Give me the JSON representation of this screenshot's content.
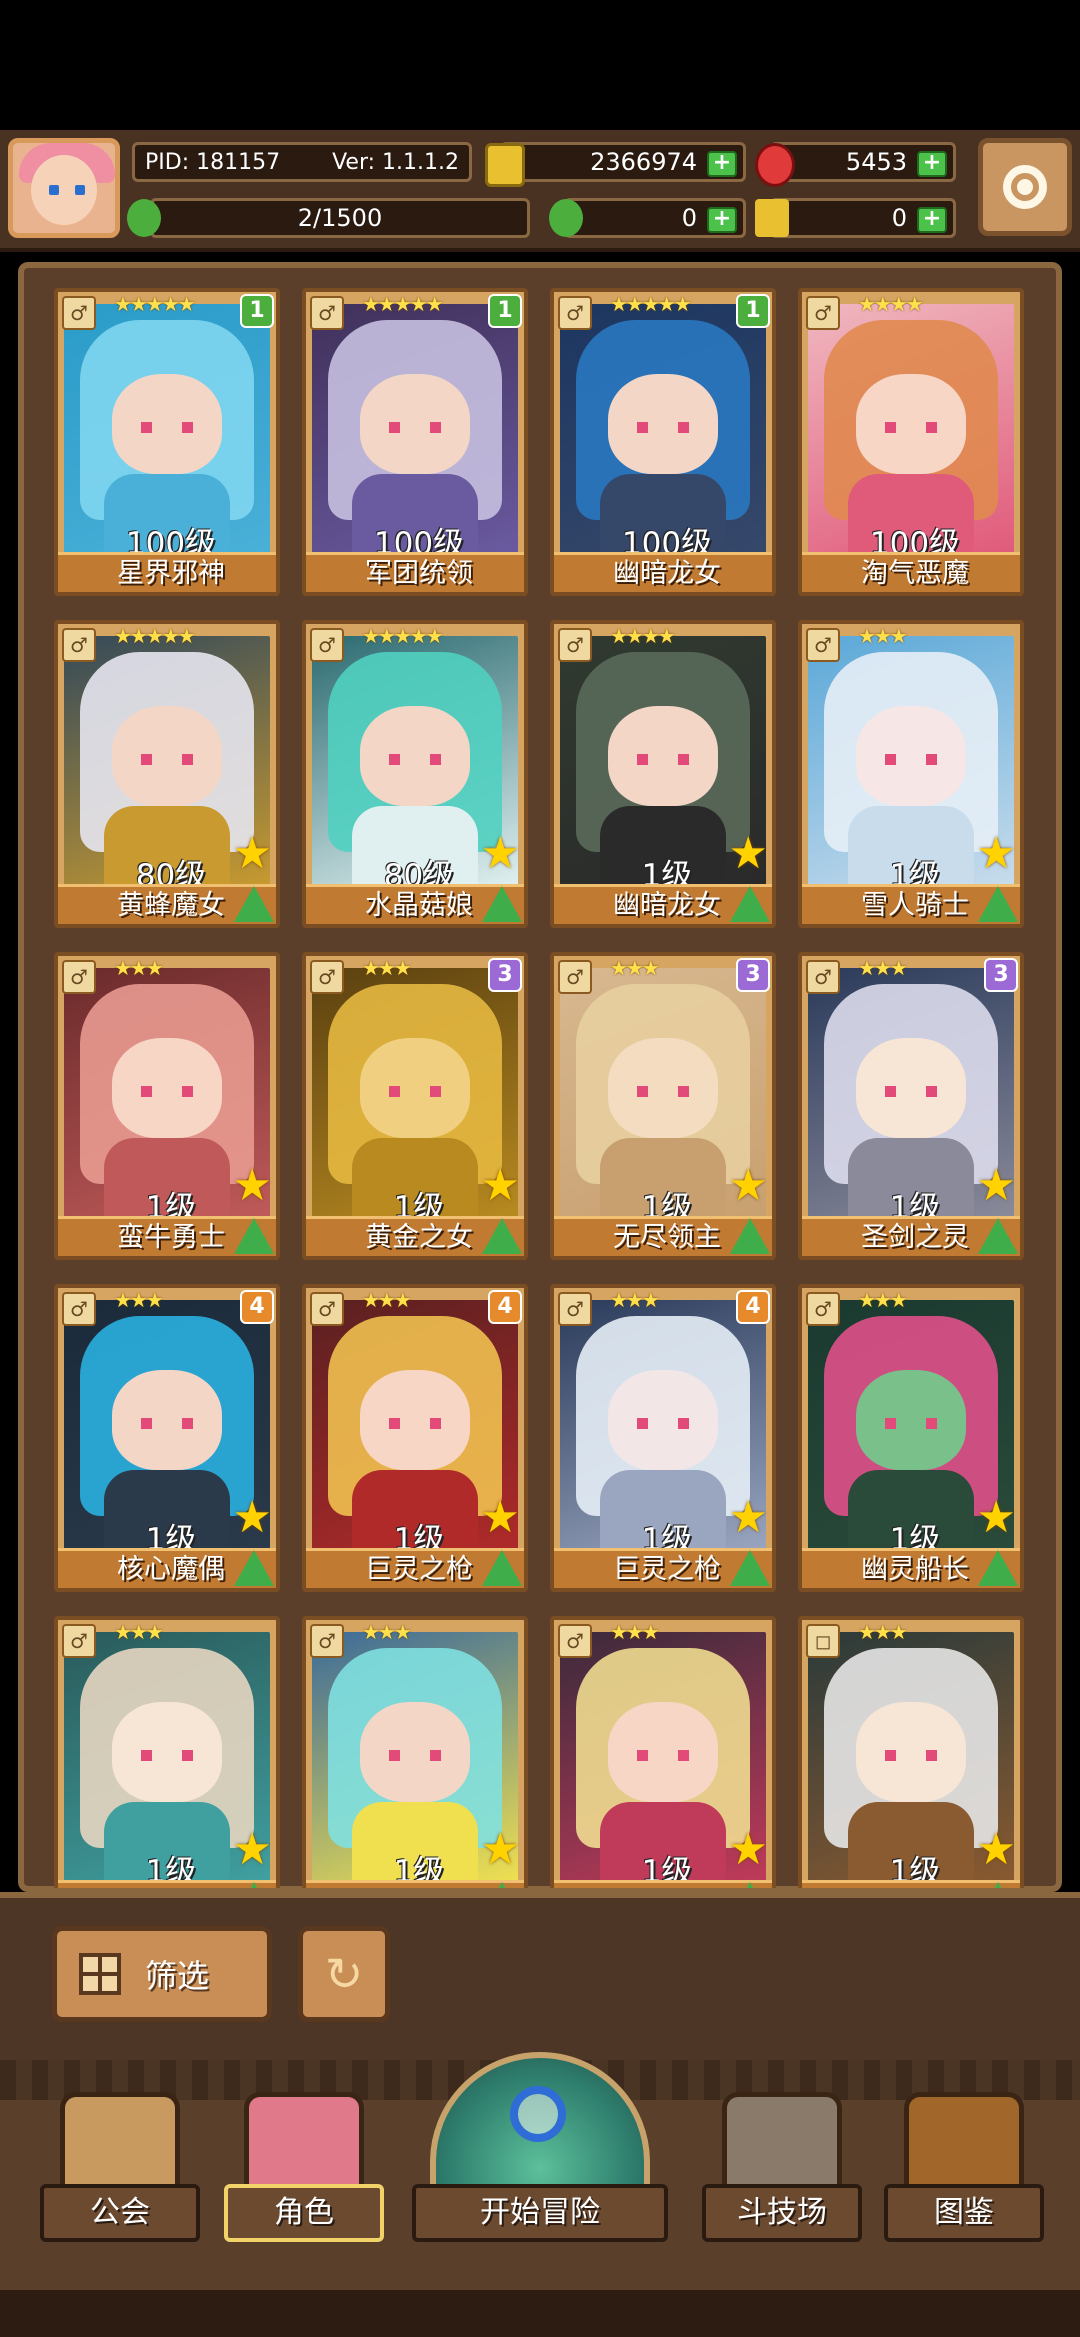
{
  "hud": {
    "pid": "PID: 181157",
    "version": "Ver: 1.1.1.2",
    "gold": "2366974",
    "gems": "5453",
    "stamina": "2/1500",
    "clover": "0",
    "key": "0"
  },
  "cards": [
    {
      "name": "星界邪神",
      "level": "100级",
      "stars": "★★★★★",
      "badge": "1",
      "badge_color": "g",
      "tag": "♂",
      "upgrade": false,
      "palette": [
        "#2a9bc8",
        "#7fd6f0",
        "#f3d6c6",
        "#4ab0d8"
      ]
    },
    {
      "name": "军团统领",
      "level": "100级",
      "stars": "★★★★★",
      "badge": "1",
      "badge_color": "g",
      "tag": "♂",
      "upgrade": false,
      "palette": [
        "#40305a",
        "#c6c0e0",
        "#f3d6c6",
        "#6a5aa0"
      ]
    },
    {
      "name": "幽暗龙女",
      "level": "100级",
      "stars": "★★★★★",
      "badge": "1",
      "badge_color": "g",
      "tag": "♂",
      "upgrade": false,
      "palette": [
        "#1c3660",
        "#2a78c0",
        "#f3d6c6",
        "#36486a"
      ]
    },
    {
      "name": "淘气恶魔",
      "level": "100级",
      "stars": "★★★★",
      "badge": "",
      "badge_color": "",
      "tag": "♂",
      "upgrade": false,
      "palette": [
        "#f0b8c0",
        "#e08a50",
        "#f7d6c6",
        "#e05a7a"
      ]
    },
    {
      "name": "黄蜂魔女",
      "level": "80级",
      "stars": "★★★★★",
      "badge": "",
      "badge_color": "",
      "tag": "♂",
      "upgrade": true,
      "palette": [
        "#33495a",
        "#e6e6f0",
        "#f3d6c6",
        "#c89a30"
      ]
    },
    {
      "name": "水晶菇娘",
      "level": "80级",
      "stars": "★★★★★",
      "badge": "",
      "badge_color": "",
      "tag": "♂",
      "upgrade": true,
      "palette": [
        "#2a6a70",
        "#50d0c0",
        "#f3d6c6",
        "#e0f0f0"
      ]
    },
    {
      "name": "幽暗龙女",
      "level": "1级",
      "stars": "★★★★",
      "badge": "",
      "badge_color": "",
      "tag": "♂",
      "upgrade": true,
      "palette": [
        "#303a30",
        "#5a6a5a",
        "#f3d6c6",
        "#2a2a2a"
      ]
    },
    {
      "name": "雪人骑士",
      "level": "1级",
      "stars": "★★★",
      "badge": "",
      "badge_color": "",
      "tag": "♂",
      "upgrade": true,
      "palette": [
        "#5aa8d8",
        "#e6eef6",
        "#f7e6e6",
        "#c8dcec"
      ]
    },
    {
      "name": "蛮牛勇士",
      "level": "1级",
      "stars": "★★★",
      "badge": "",
      "badge_color": "",
      "tag": "♂",
      "upgrade": true,
      "palette": [
        "#6a2a2a",
        "#e89a90",
        "#f7d6c6",
        "#c05a5a"
      ]
    },
    {
      "name": "黄金之女",
      "level": "1级",
      "stars": "★★★",
      "badge": "3",
      "badge_color": "p",
      "tag": "♂",
      "upgrade": true,
      "palette": [
        "#5a4010",
        "#e6b840",
        "#f0d080",
        "#b88a20"
      ]
    },
    {
      "name": "无尽领主",
      "level": "1级",
      "stars": "★★★",
      "badge": "3",
      "badge_color": "p",
      "tag": "♂",
      "upgrade": true,
      "palette": [
        "#d8b890",
        "#e8cfa0",
        "#f3dcc0",
        "#c8a070"
      ]
    },
    {
      "name": "圣剑之灵",
      "level": "1级",
      "stars": "★★★",
      "badge": "3",
      "badge_color": "p",
      "tag": "♂",
      "upgrade": true,
      "palette": [
        "#2a3a5a",
        "#dcdcec",
        "#f7e6d6",
        "#8a8a9a"
      ]
    },
    {
      "name": "核心魔偶",
      "level": "1级",
      "stars": "★★★",
      "badge": "4",
      "badge_color": "o",
      "tag": "♂",
      "upgrade": true,
      "palette": [
        "#1a2a3a",
        "#2ab0e0",
        "#f3d6c6",
        "#2a3a4a"
      ]
    },
    {
      "name": "巨灵之枪",
      "level": "1级",
      "stars": "★★★",
      "badge": "4",
      "badge_color": "o",
      "tag": "♂",
      "upgrade": true,
      "palette": [
        "#5a2020",
        "#f0c050",
        "#f7d6c6",
        "#b02a2a"
      ]
    },
    {
      "name": "巨灵之枪",
      "level": "1级",
      "stars": "★★★",
      "badge": "4",
      "badge_color": "o",
      "tag": "♂",
      "upgrade": true,
      "palette": [
        "#2a3a5a",
        "#e6eef6",
        "#f3e6e6",
        "#9aa6c0"
      ]
    },
    {
      "name": "幽灵船长",
      "level": "1级",
      "stars": "★★★",
      "badge": "",
      "badge_color": "",
      "tag": "♂",
      "upgrade": true,
      "palette": [
        "#1a3a30",
        "#e0508a",
        "#7ac08a",
        "#2a4a3a"
      ]
    },
    {
      "name": "",
      "level": "1级",
      "stars": "★★★",
      "badge": "",
      "badge_color": "",
      "tag": "♂",
      "upgrade": true,
      "palette": [
        "#2a5a5a",
        "#e6d6c0",
        "#f7e6d6",
        "#40a0a0"
      ]
    },
    {
      "name": "",
      "level": "1级",
      "stars": "★★★",
      "badge": "",
      "badge_color": "",
      "tag": "♂",
      "upgrade": true,
      "palette": [
        "#3a6a9a",
        "#80e0e0",
        "#f3d6c6",
        "#f0e050"
      ]
    },
    {
      "name": "",
      "level": "1级",
      "stars": "★★★",
      "badge": "",
      "badge_color": "",
      "tag": "♂",
      "upgrade": true,
      "palette": [
        "#3a2a3a",
        "#f0dc90",
        "#f7d6c6",
        "#c03a5a"
      ]
    },
    {
      "name": "",
      "level": "1级",
      "stars": "★★★",
      "badge": "",
      "badge_color": "",
      "tag": "◻",
      "upgrade": true,
      "palette": [
        "#2a3a3a",
        "#e6e6e6",
        "#f7e6d6",
        "#8a5a30"
      ]
    }
  ],
  "toolbar": {
    "filter_label": "筛选",
    "refresh_icon": "refresh-icon"
  },
  "nav": {
    "guild": "公会",
    "character": "角色",
    "adventure": "开始冒险",
    "arena": "斗技场",
    "codex": "图鉴"
  }
}
